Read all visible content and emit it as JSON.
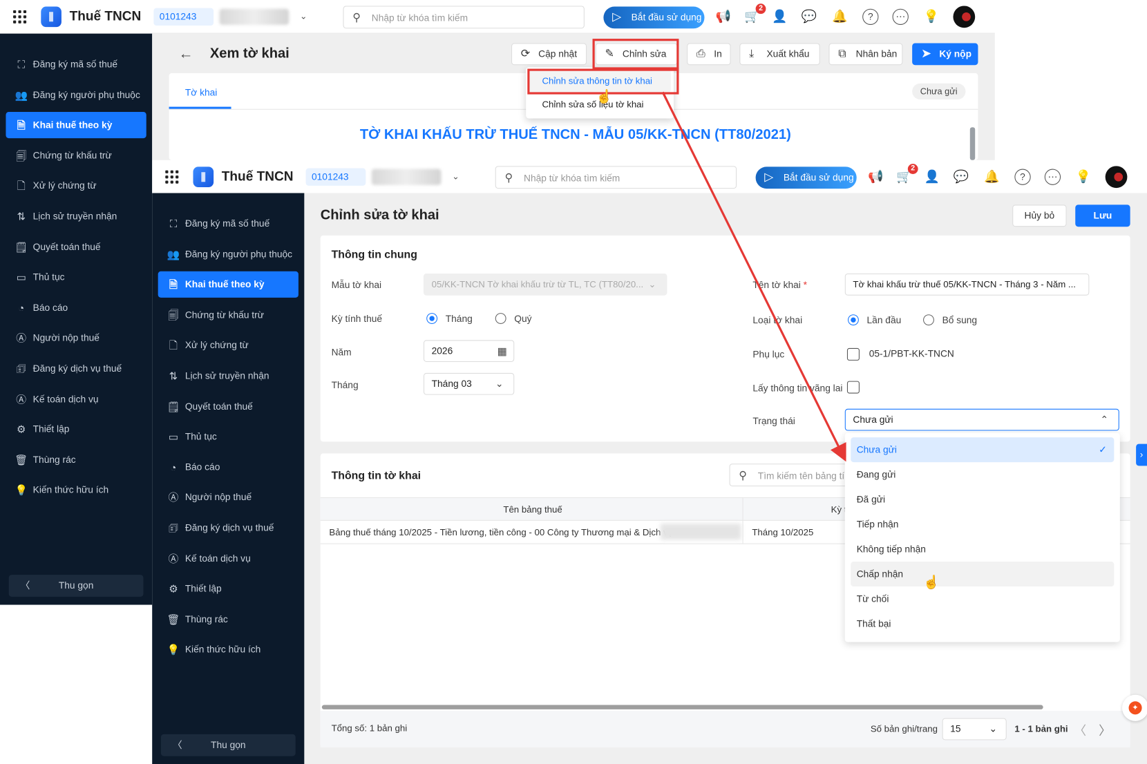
{
  "app": {
    "name": "Thuế TNCN",
    "tax_id": "0101243",
    "search_placeholder": "Nhập từ khóa tìm kiếm",
    "start_label": "Bắt đầu sử dụng",
    "cart_badge": "2"
  },
  "sidebar": {
    "items": [
      {
        "label": "Đăng ký mã số thuế",
        "icon": "⛶",
        "name": "register-tax-code"
      },
      {
        "label": "Đăng ký người phụ thuộc",
        "icon": "👥",
        "name": "register-dependents"
      },
      {
        "label": "Khai thuế theo kỳ",
        "icon": "🗎",
        "name": "periodic-tax-declaration",
        "active": true
      },
      {
        "label": "Chứng từ khấu trừ",
        "icon": "🗐",
        "name": "withholding-vouchers"
      },
      {
        "label": "Xử lý chứng từ",
        "icon": "🗋",
        "name": "process-vouchers"
      },
      {
        "label": "Lịch sử truyền nhận",
        "icon": "⇅",
        "name": "transmission-history"
      },
      {
        "label": "Quyết toán thuế",
        "icon": "🗒",
        "name": "tax-finalization"
      },
      {
        "label": "Thủ tục",
        "icon": "▭",
        "name": "procedures"
      },
      {
        "label": "Báo cáo",
        "icon": "◔",
        "name": "reports"
      },
      {
        "label": "Người nộp thuế",
        "icon": "Ⓐ",
        "name": "taxpayers"
      },
      {
        "label": "Đăng ký dịch vụ thuế",
        "icon": "🗊",
        "name": "register-tax-service"
      },
      {
        "label": "Kế toán dịch vụ",
        "icon": "Ⓐ",
        "name": "service-accounting"
      },
      {
        "label": "Thiết lập",
        "icon": "⚙",
        "name": "settings"
      },
      {
        "label": "Thùng rác",
        "icon": "🗑",
        "name": "trash"
      },
      {
        "label": "Kiến thức hữu ích",
        "icon": "💡",
        "name": "useful-knowledge"
      }
    ],
    "collapse_label": "Thu gọn"
  },
  "view": {
    "title": "Xem tờ khai",
    "buttons": {
      "refresh": "Cập nhật",
      "edit": "Chỉnh sửa",
      "print": "In",
      "export": "Xuất khẩu",
      "duplicate": "Nhân bản",
      "sign_submit": "Ký nộp"
    },
    "tab": "Tờ khai",
    "status_badge": "Chưa gửi",
    "heading": "TỜ KHAI KHẤU TRỪ THUẾ TNCN - MẪU 05/KK-TNCN (TT80/2021)",
    "edit_menu": [
      "Chỉnh sửa thông tin tờ khai",
      "Chỉnh sửa số liệu tờ khai"
    ]
  },
  "edit": {
    "title": "Chỉnh sửa tờ khai",
    "cancel": "Hủy bỏ",
    "save": "Lưu",
    "general": {
      "title": "Thông tin chung",
      "template_label": "Mẫu tờ khai",
      "template_value": "05/KK-TNCN Tờ khai khấu trừ từ TL, TC (TT80/20...",
      "period_label": "Kỳ tính thuế",
      "period_month": "Tháng",
      "period_quarter": "Quý",
      "year_label": "Năm",
      "year_value": "2026",
      "month_label": "Tháng",
      "month_value": "Tháng 03",
      "name_label": "Tên tờ khai",
      "required": "*",
      "name_value": "Tờ khai khấu trừ thuế 05/KK-TNCN - Tháng 3 - Năm ...",
      "type_label": "Loại tờ khai",
      "type_first": "Lần đầu",
      "type_supplement": "Bổ sung",
      "appendix_label": "Phụ lục",
      "appendix_value": "05-1/PBT-KK-TNCN",
      "visitor_label": "Lấy thông tin vãng lai",
      "status_label": "Trạng thái",
      "status_value": "Chưa gửi",
      "status_options": [
        "Chưa gửi",
        "Đang gửi",
        "Đã gửi",
        "Tiếp nhận",
        "Không tiếp nhận",
        "Chấp nhận",
        "Từ chối",
        "Thất bại"
      ]
    },
    "info": {
      "title": "Thông tin tờ khai",
      "search_placeholder": "Tìm kiếm tên bảng tính",
      "columns": [
        "Tên bảng thuế",
        "Kỳ tính thuế"
      ],
      "rows": [
        [
          "Bảng thuế tháng 10/2025 - Tiền lương, tiền công - 00 Công ty Thương mại & Dịch vụ",
          "Tháng 10/2025"
        ]
      ],
      "total": "Tổng số: 1 bản ghi",
      "page_size_label": "Số bản ghi/trang",
      "page_size": "15",
      "range": "1 - 1 bản ghi"
    }
  },
  "colors": {
    "accent": "#1677ff",
    "sidebar": "#0c1a2b",
    "annotation": "#e53935"
  }
}
